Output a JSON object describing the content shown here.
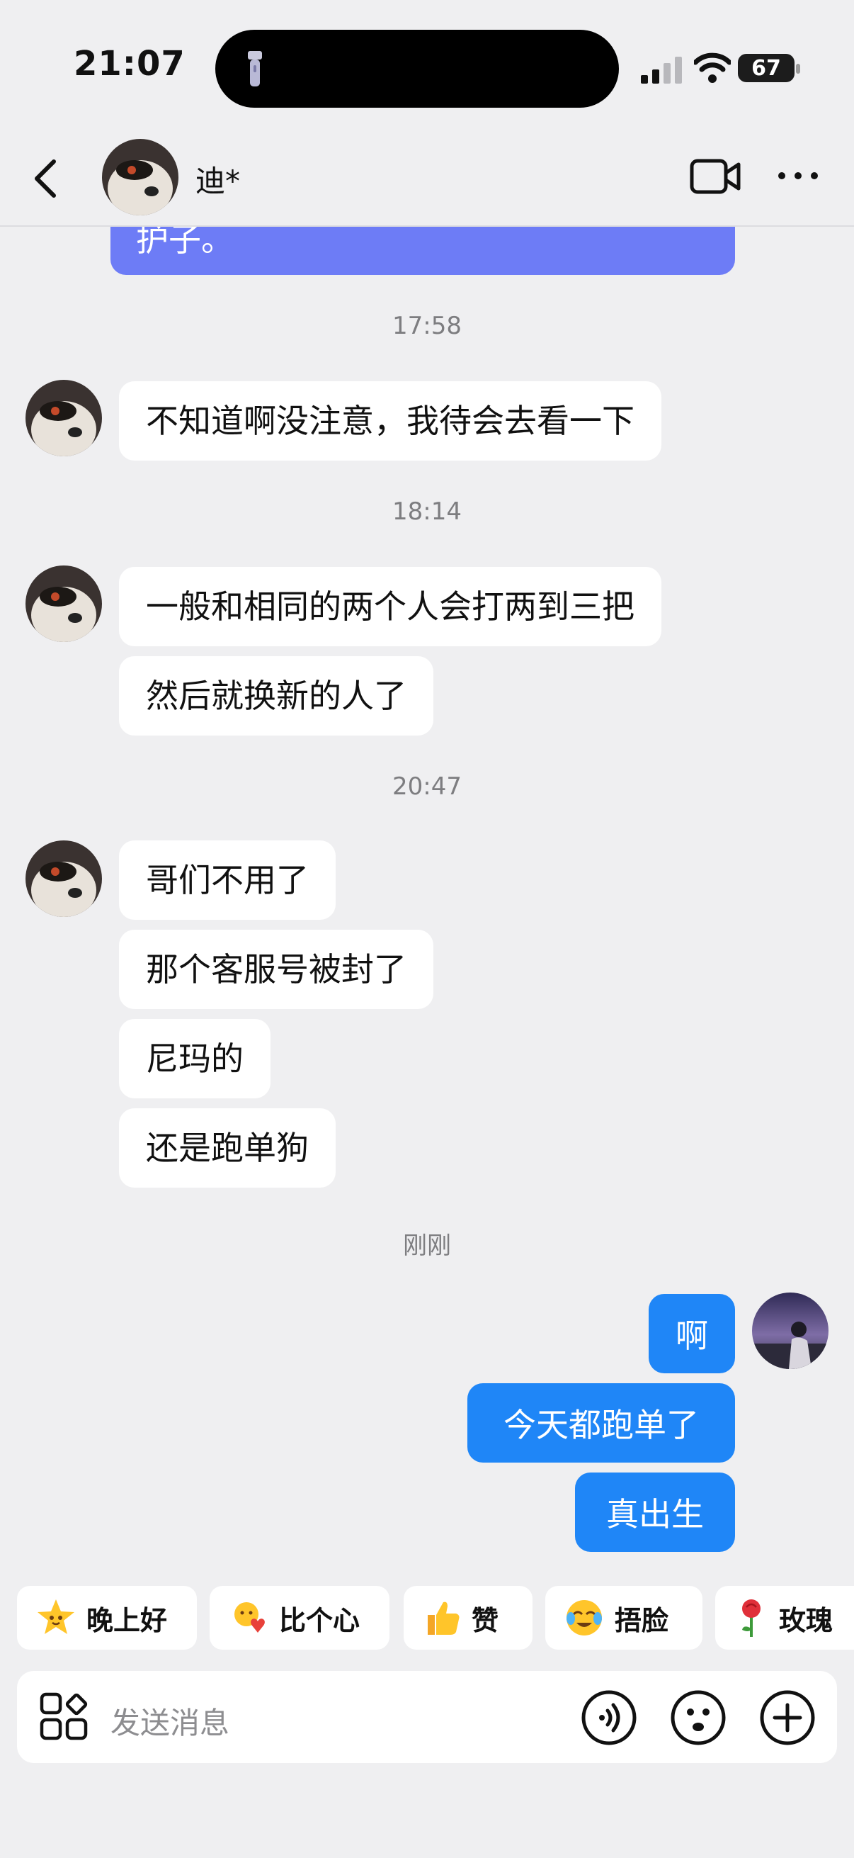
{
  "status_bar": {
    "time": "21:07",
    "battery": "67"
  },
  "header": {
    "contact_name": "迪*"
  },
  "messages": {
    "cut_text": "护子。",
    "stamp1": "17:58",
    "m1": "不知道啊没注意，我待会去看一下",
    "stamp2": "18:14",
    "m2": "一般和相同的两个人会打两到三把",
    "m3": "然后就换新的人了",
    "stamp3": "20:47",
    "m4": "哥们不用了",
    "m5": "那个客服号被封了",
    "m6": "尼玛的",
    "m7": "还是跑单狗",
    "stamp4": "刚刚",
    "out1": "啊",
    "out2": "今天都跑单了",
    "out3": "真出生"
  },
  "quick_replies": [
    "晚上好",
    "比个心",
    "赞",
    "捂脸",
    "玫瑰"
  ],
  "input": {
    "placeholder": "发送消息"
  },
  "colors": {
    "outgoing": "#1f86f7",
    "purple_card": "#6d7cf6",
    "background": "#efeff1"
  },
  "icons": [
    "flashlight-icon",
    "signal-icon",
    "wifi-icon",
    "battery-icon",
    "back-icon",
    "video-call-icon",
    "more-icon",
    "star-face-icon",
    "heart-hands-icon",
    "thumbs-up-icon",
    "facepalm-icon",
    "rose-icon",
    "apps-icon",
    "voice-icon",
    "emoji-icon",
    "plus-icon"
  ]
}
